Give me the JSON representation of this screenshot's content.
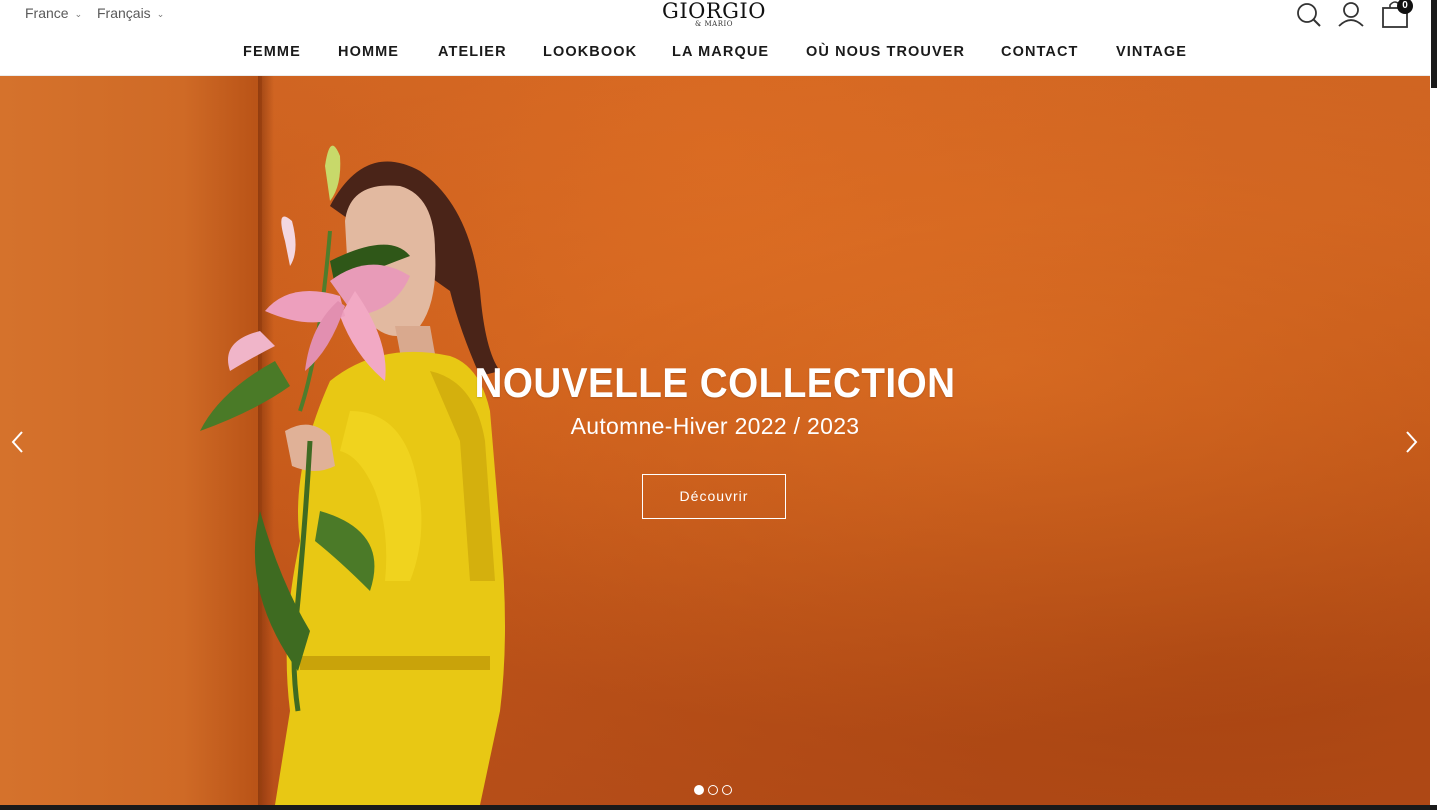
{
  "header": {
    "country": "France",
    "language": "Français",
    "logo": {
      "main": "GIORGIO",
      "sub": "& MARIO"
    },
    "cart_count": "0"
  },
  "nav": {
    "items": [
      {
        "label": "FEMME"
      },
      {
        "label": "HOMME"
      },
      {
        "label": "ATELIER"
      },
      {
        "label": "LOOKBOOK"
      },
      {
        "label": "LA MARQUE"
      },
      {
        "label": "OÙ NOUS TROUVER"
      },
      {
        "label": "CONTACT"
      },
      {
        "label": "VINTAGE"
      }
    ]
  },
  "hero": {
    "title": "NOUVELLE COLLECTION",
    "subtitle": "Automne-Hiver 2022 / 2023",
    "cta": "Découvrir",
    "slide_count": 3,
    "active_slide": 1
  },
  "icons": {
    "search": "search-icon",
    "account": "user-icon",
    "cart": "shopping-bag-icon",
    "prev": "chevron-left-icon",
    "next": "chevron-right-icon"
  },
  "colors": {
    "hero_background": "#c85b1a",
    "jacket": "#e8c814",
    "text_dark": "#1a1a1a"
  }
}
